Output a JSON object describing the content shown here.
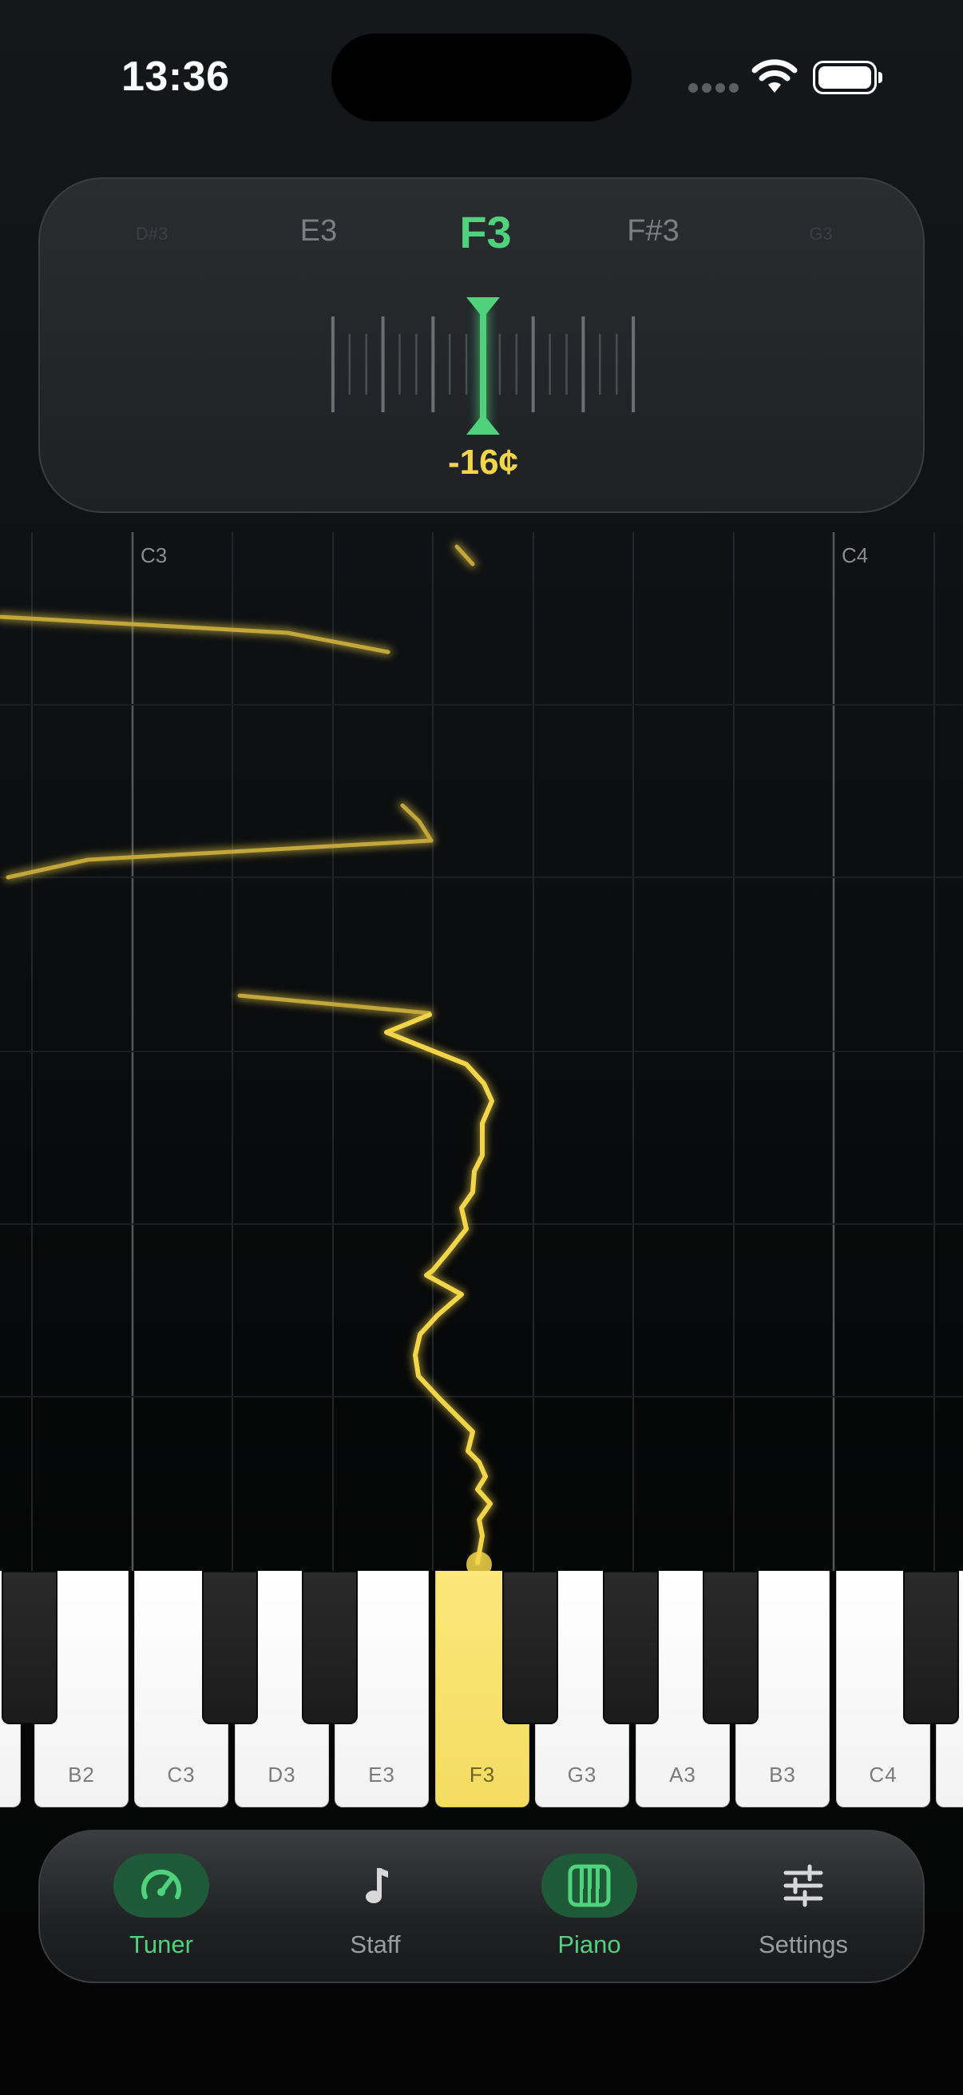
{
  "status_bar": {
    "time": "13:36"
  },
  "tuner": {
    "notes": [
      {
        "label": "D#3",
        "role": "far"
      },
      {
        "label": "E3",
        "role": "near"
      },
      {
        "label": "F3",
        "role": "current"
      },
      {
        "label": "F#3",
        "role": "near"
      },
      {
        "label": "G3",
        "role": "far"
      }
    ],
    "cents_readout": "-16¢",
    "cents_value": -16,
    "accent_color": "#4fd27b",
    "pitch_color": "#f3d549"
  },
  "pitch_graph": {
    "axis_labels": [
      "C3",
      "C4"
    ]
  },
  "keyboard": {
    "white_keys": [
      "",
      "B2",
      "C3",
      "D3",
      "E3",
      "F3",
      "G3",
      "A3",
      "B3",
      "C4",
      ""
    ],
    "active_key": "F3"
  },
  "tabbar": {
    "tabs": [
      {
        "label": "Tuner",
        "icon": "gauge-icon",
        "active": true
      },
      {
        "label": "Staff",
        "icon": "music-note-icon",
        "active": false
      },
      {
        "label": "Piano",
        "icon": "piano-icon",
        "active": true
      },
      {
        "label": "Settings",
        "icon": "sliders-icon",
        "active": false
      }
    ]
  }
}
